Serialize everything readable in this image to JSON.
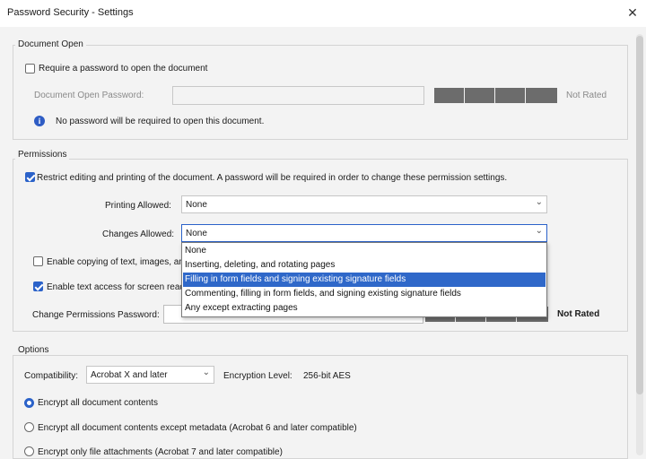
{
  "window": {
    "title": "Password Security - Settings",
    "close_glyph": "✕"
  },
  "document_open": {
    "group_label": "Document Open",
    "require_password_label": "Require a password to open the document",
    "require_password_checked": false,
    "password_label": "Document Open Password:",
    "password_value": "",
    "strength": "Not Rated",
    "info_text": "No password will be required to open this document."
  },
  "permissions": {
    "group_label": "Permissions",
    "restrict_label": "Restrict editing and printing of the document. A password will be required in order to change these permission settings.",
    "restrict_checked": true,
    "printing_label": "Printing Allowed:",
    "printing_value": "None",
    "changes_label": "Changes Allowed:",
    "changes_value": "None",
    "changes_options": [
      "None",
      "Inserting, deleting, and rotating pages",
      "Filling in form fields and signing existing signature fields",
      "Commenting, filling in form fields, and signing existing signature fields",
      "Any except extracting pages"
    ],
    "highlighted_option_index": 2,
    "enable_copying_label": "Enable copying of text, images, and",
    "enable_copying_checked": false,
    "enable_text_access_label": "Enable text access for screen reade",
    "enable_text_access_checked": true,
    "change_password_label": "Change Permissions Password:",
    "change_password_value": "",
    "strength": "Not Rated"
  },
  "options": {
    "group_label": "Options",
    "compatibility_label": "Compatibility:",
    "compatibility_value": "Acrobat X and later",
    "encryption_label": "Encryption  Level:",
    "encryption_value": "256-bit AES",
    "radios": [
      {
        "label": "Encrypt all document contents",
        "checked": true
      },
      {
        "label": "Encrypt all document contents except metadata (Acrobat 6 and later compatible)",
        "checked": false
      },
      {
        "label": "Encrypt only file attachments (Acrobat 7 and later compatible)",
        "checked": false
      }
    ]
  },
  "colors": {
    "accent": "#2b62c9",
    "highlight": "#2f68c9",
    "strength_bar": "#6c6c6c"
  },
  "icons": {
    "info": "info-icon",
    "close": "close-icon",
    "dropdown": "chevron-down-icon"
  }
}
